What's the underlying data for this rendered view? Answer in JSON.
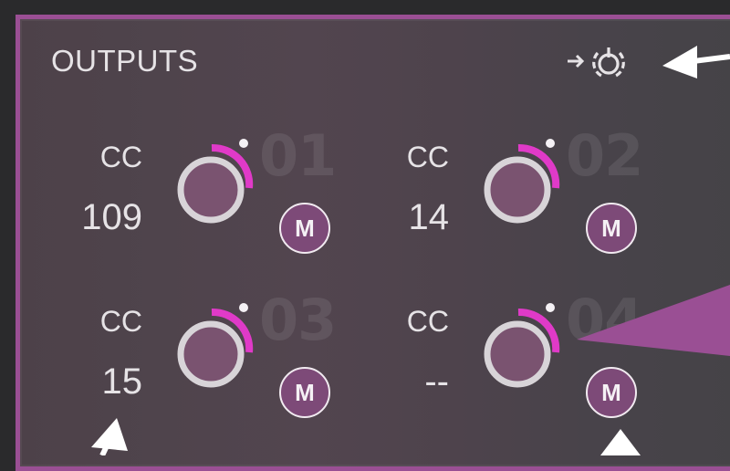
{
  "panel": {
    "title": "OUTPUTS",
    "sync_icon": "arrow-into-power-icon"
  },
  "colors": {
    "accent": "#e03ac8",
    "border": "#9a4f94",
    "mute_fill": "#7d4a78",
    "knob_body": "#7a5370",
    "knob_ring": "#d8d4d8",
    "callout": "#9a4f94"
  },
  "channels": [
    {
      "number": "01",
      "cc_label": "CC",
      "cc_value": "109",
      "mute_label": "M",
      "knob_level": 0.35
    },
    {
      "number": "02",
      "cc_label": "CC",
      "cc_value": "14",
      "mute_label": "M",
      "knob_level": 0.35
    },
    {
      "number": "03",
      "cc_label": "CC",
      "cc_value": "15",
      "mute_label": "M",
      "knob_level": 0.35
    },
    {
      "number": "04",
      "cc_label": "CC",
      "cc_value": "--",
      "mute_label": "M",
      "knob_level": 0.35
    }
  ]
}
